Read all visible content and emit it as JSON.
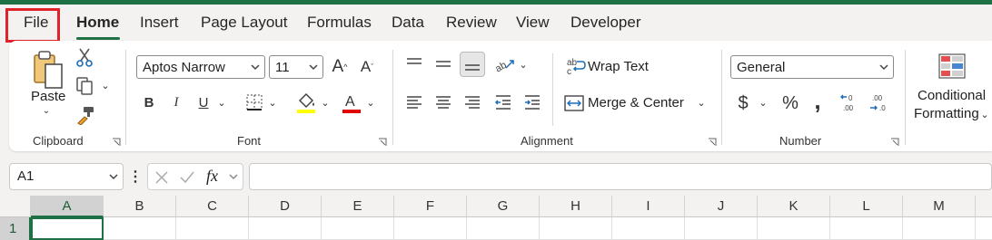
{
  "tabs": [
    "File",
    "Home",
    "Insert",
    "Page Layout",
    "Formulas",
    "Data",
    "Review",
    "View",
    "Developer"
  ],
  "active_tab": "Home",
  "colors": {
    "accent": "#1e7145",
    "highlight_box": "#e0222a",
    "fill_yellow": "#ffff00",
    "font_red": "#e00000"
  },
  "clipboard": {
    "paste_label": "Paste",
    "group_label": "Clipboard"
  },
  "font": {
    "name": "Aptos Narrow",
    "size": "11",
    "group_label": "Font",
    "bold": "B",
    "italic": "I",
    "underline": "U"
  },
  "alignment": {
    "wrap_text": "Wrap Text",
    "merge_center": "Merge & Center",
    "group_label": "Alignment"
  },
  "number": {
    "format": "General",
    "currency": "$",
    "percent": "%",
    "comma": ",",
    "group_label": "Number"
  },
  "styles": {
    "conditional_line1": "Conditional",
    "conditional_line2": "Formatting"
  },
  "formula_bar": {
    "name_box": "A1",
    "fx": "fx",
    "formula": ""
  },
  "columns": [
    "A",
    "B",
    "C",
    "D",
    "E",
    "F",
    "G",
    "H",
    "I",
    "J",
    "K",
    "L",
    "M"
  ],
  "rows": [
    "1"
  ],
  "selected_cell": "A1"
}
